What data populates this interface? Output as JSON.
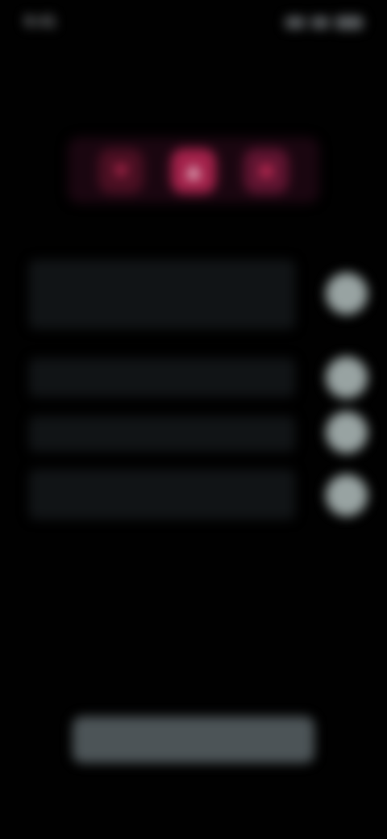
{
  "status_bar": {
    "time": "9:41",
    "icons": [
      "signal-icon",
      "wifi-icon",
      "battery-icon"
    ]
  },
  "header": {
    "kicker": "",
    "headline": ""
  },
  "feature_strip": {
    "icons": [
      "heart-icon",
      "shield-icon",
      "star-icon"
    ],
    "caption": ""
  },
  "settings": [
    {
      "label": "",
      "enabled": true
    },
    {
      "label": "",
      "enabled": true
    },
    {
      "label": "",
      "enabled": true
    },
    {
      "label": "",
      "enabled": true
    }
  ],
  "cta": {
    "label": ""
  },
  "colors": {
    "background": "#010101",
    "accent": "#a3214a",
    "accent_dark": "#4a0f22",
    "toggle": "#98a3a2",
    "button": "#4c5457"
  }
}
